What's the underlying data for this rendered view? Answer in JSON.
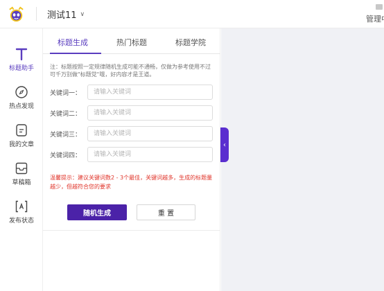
{
  "header": {
    "logo_icon": "alien-mascot-icon",
    "project_name": "测试11",
    "project_chevron": "∨",
    "manage_label": "管理中"
  },
  "sidebar": {
    "items": [
      {
        "label": "标题助手",
        "icon": "title-T-icon",
        "active": true
      },
      {
        "label": "热点发现",
        "icon": "compass-icon",
        "active": false
      },
      {
        "label": "我的文章",
        "icon": "document-icon",
        "active": false
      },
      {
        "label": "草稿箱",
        "icon": "inbox-icon",
        "active": false
      },
      {
        "label": "发布状态",
        "icon": "publish-frame-icon",
        "active": false
      }
    ]
  },
  "tabs": [
    {
      "label": "标题生成",
      "active": true
    },
    {
      "label": "热门标题",
      "active": false
    },
    {
      "label": "标题学院",
      "active": false
    }
  ],
  "form": {
    "note": "注：标题按照一定规律随机生成可能不通畅，仅做为参考使用不过可千万别做\"标题党\"哦，好内容才是王道。",
    "keywords": [
      {
        "label": "关键词一：",
        "placeholder": "请输入关键词",
        "value": ""
      },
      {
        "label": "关键词二：",
        "placeholder": "请输入关键词",
        "value": ""
      },
      {
        "label": "关键词三：",
        "placeholder": "请输入关键词",
        "value": ""
      },
      {
        "label": "关键词四：",
        "placeholder": "请输入关键词",
        "value": ""
      }
    ],
    "tip": "温馨提示：建议关键词数2 - 3个最佳，关键词越多，生成的标题量越少，但越符合您的要求",
    "generate_label": "随机生成",
    "reset_label": "重 置"
  },
  "collapse_handle": {
    "glyph": "‹"
  },
  "colors": {
    "accent": "#5a3dbf",
    "primary_button": "#4b22a8",
    "tip_text": "#e0342a",
    "canvas_bg": "#f0f1f5"
  }
}
